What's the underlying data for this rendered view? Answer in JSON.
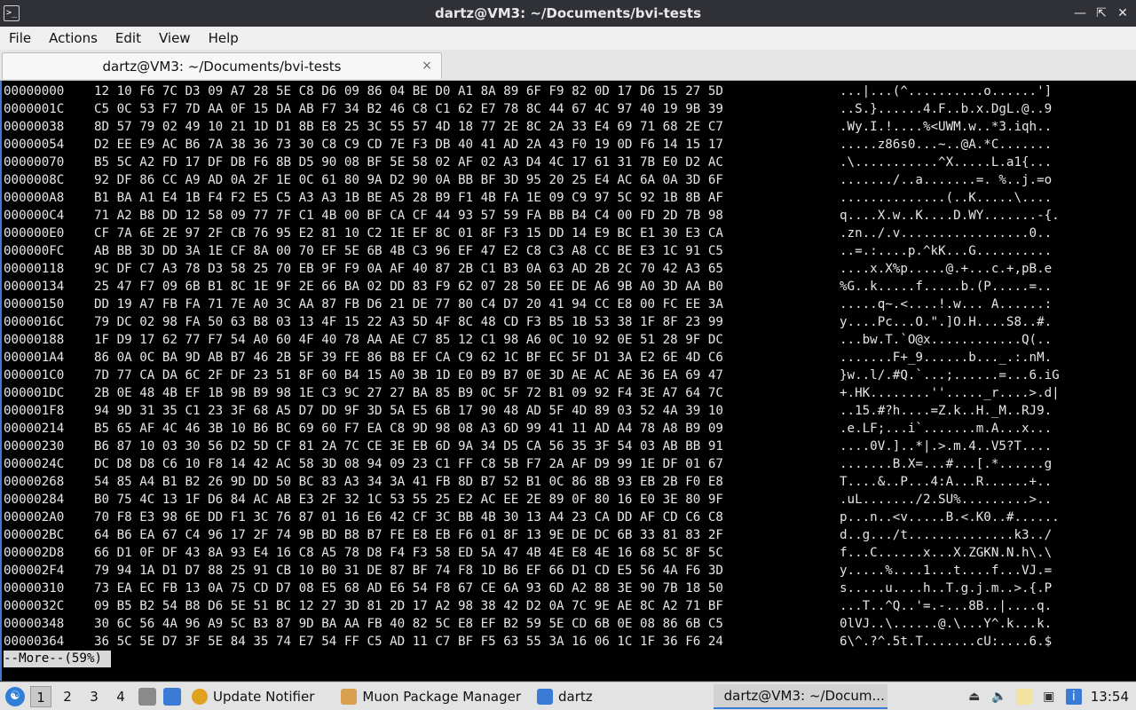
{
  "window": {
    "title": "dartz@VM3: ~/Documents/bvi-tests",
    "buttons": [
      "minimize",
      "restore",
      "close"
    ]
  },
  "menubar": {
    "items": [
      "File",
      "Actions",
      "Edit",
      "View",
      "Help"
    ]
  },
  "tab": {
    "label": "dartz@VM3: ~/Documents/bvi-tests",
    "close": "×"
  },
  "terminal": {
    "rows": [
      {
        "addr": "00000000",
        "bytes": "12 10 F6 7C D3 09 A7 28 5E C8 D6 09 86 04 BE D0 A1 8A 89 6F F9 82 0D 17 D6 15 27 5D",
        "ascii": "...|...(^..........o......']"
      },
      {
        "addr": "0000001C",
        "bytes": "C5 0C 53 F7 7D AA 0F 15 DA AB F7 34 B2 46 C8 C1 62 E7 78 8C 44 67 4C 97 40 19 9B 39",
        "ascii": "..S.}......4.F..b.x.DgL.@..9"
      },
      {
        "addr": "00000038",
        "bytes": "8D 57 79 02 49 10 21 1D D1 8B E8 25 3C 55 57 4D 18 77 2E 8C 2A 33 E4 69 71 68 2E C7",
        "ascii": ".Wy.I.!....%<UWM.w..*3.iqh.."
      },
      {
        "addr": "00000054",
        "bytes": "D2 EE E9 AC B6 7A 38 36 73 30 C8 C9 CD 7E F3 DB 40 41 AD 2A 43 F0 19 0D F6 14 15 17",
        "ascii": ".....z86s0...~..@A.*C......."
      },
      {
        "addr": "00000070",
        "bytes": "B5 5C A2 FD 17 DF DB F6 8B D5 90 08 BF 5E 58 02 AF 02 A3 D4 4C 17 61 31 7B E0 D2 AC",
        "ascii": ".\\...........^X.....L.a1{..."
      },
      {
        "addr": "0000008C",
        "bytes": "92 DF 86 CC A9 AD 0A 2F 1E 0C 61 80 9A D2 90 0A BB BF 3D 95 20 25 E4 AC 6A 0A 3D 6F",
        "ascii": "......./..a.......=. %..j.=o"
      },
      {
        "addr": "000000A8",
        "bytes": "B1 BA A1 E4 1B F4 F2 E5 C5 A3 A3 1B BE A5 28 B9 F1 4B FA 1E 09 C9 97 5C 92 1B 8B AF",
        "ascii": "..............(..K.....\\...."
      },
      {
        "addr": "000000C4",
        "bytes": "71 A2 B8 DD 12 58 09 77 7F C1 4B 00 BF CA CF 44 93 57 59 FA BB B4 C4 00 FD 2D 7B 98",
        "ascii": "q....X.w..K....D.WY.......-{."
      },
      {
        "addr": "000000E0",
        "bytes": "CF 7A 6E 2E 97 2F CB 76 95 E2 81 10 C2 1E EF 8C 01 8F F3 15 DD 14 E9 BC E1 30 E3 CA",
        "ascii": ".zn../.v.................0.."
      },
      {
        "addr": "000000FC",
        "bytes": "AB BB 3D DD 3A 1E CF 8A 00 70 EF 5E 6B 4B C3 96 EF 47 E2 C8 C3 A8 CC BE E3 1C 91 C5",
        "ascii": "..=.:....p.^kK...G.........."
      },
      {
        "addr": "00000118",
        "bytes": "9C DF C7 A3 78 D3 58 25 70 EB 9F F9 0A AF 40 87 2B C1 B3 0A 63 AD 2B 2C 70 42 A3 65",
        "ascii": "....x.X%p.....@.+...c.+,pB.e"
      },
      {
        "addr": "00000134",
        "bytes": "25 47 F7 09 6B B1 8C 1E 9F 2E 66 BA 02 DD 83 F9 62 07 28 50 EE DE A6 9B A0 3D AA B0",
        "ascii": "%G..k.....f.....b.(P.....=.."
      },
      {
        "addr": "00000150",
        "bytes": "DD 19 A7 FB FA 71 7E A0 3C AA 87 FB D6 21 DE 77 80 C4 D7 20 41 94 CC E8 00 FC EE 3A",
        "ascii": ".....q~.<....!.w... A......:"
      },
      {
        "addr": "0000016C",
        "bytes": "79 DC 02 98 FA 50 63 B8 03 13 4F 15 22 A3 5D 4F 8C 48 CD F3 B5 1B 53 38 1F 8F 23 99",
        "ascii": "y....Pc...O.\".]O.H....S8..#."
      },
      {
        "addr": "00000188",
        "bytes": "1F D9 17 62 77 F7 54 A0 60 4F 40 78 AA AE C7 85 12 C1 98 A6 0C 10 92 0E 51 28 9F DC",
        "ascii": "...bw.T.`O@x............Q(.."
      },
      {
        "addr": "000001A4",
        "bytes": "86 0A 0C BA 9D AB B7 46 2B 5F 39 FE 86 B8 EF CA C9 62 1C BF EC 5F D1 3A E2 6E 4D C6",
        "ascii": ".......F+_9......b..._.:.nM."
      },
      {
        "addr": "000001C0",
        "bytes": "7D 77 CA DA 6C 2F DF 23 51 8F 60 B4 15 A0 3B 1D E0 B9 B7 0E 3D AE AC AE 36 EA 69 47",
        "ascii": "}w..l/.#Q.`...;......=...6.iG"
      },
      {
        "addr": "000001DC",
        "bytes": "2B 0E 48 4B EF 1B 9B B9 98 1E C3 9C 27 27 BA 85 B9 0C 5F 72 B1 09 92 F4 3E A7 64 7C",
        "ascii": "+.HK........''....._r....>.d|"
      },
      {
        "addr": "000001F8",
        "bytes": "94 9D 31 35 C1 23 3F 68 A5 D7 DD 9F 3D 5A E5 6B 17 90 48 AD 5F 4D 89 03 52 4A 39 10",
        "ascii": "..15.#?h....=Z.k..H._M..RJ9."
      },
      {
        "addr": "00000214",
        "bytes": "B5 65 AF 4C 46 3B 10 B6 BC 69 60 F7 EA C8 9D 98 08 A3 6D 99 41 11 AD A4 78 A8 B9 09",
        "ascii": ".e.LF;...i`.......m.A...x..."
      },
      {
        "addr": "00000230",
        "bytes": "B6 87 10 03 30 56 D2 5D CF 81 2A 7C CE 3E EB 6D 9A 34 D5 CA 56 35 3F 54 03 AB BB 91",
        "ascii": "....0V.]..*|.>.m.4..V5?T...."
      },
      {
        "addr": "0000024C",
        "bytes": "DC D8 D8 C6 10 F8 14 42 AC 58 3D 08 94 09 23 C1 FF C8 5B F7 2A AF D9 99 1E DF 01 67",
        "ascii": ".......B.X=...#...[.*......g"
      },
      {
        "addr": "00000268",
        "bytes": "54 85 A4 B1 B2 26 9D DD 50 BC 83 A3 34 3A 41 FB 8D B7 52 B1 0C 86 8B 93 EB 2B F0 E8",
        "ascii": "T....&..P...4:A...R......+.."
      },
      {
        "addr": "00000284",
        "bytes": "B0 75 4C 13 1F D6 84 AC AB E3 2F 32 1C 53 55 25 E2 AC EE 2E 89 0F 80 16 E0 3E 80 9F",
        "ascii": ".uL......./2.SU%.........>.."
      },
      {
        "addr": "000002A0",
        "bytes": "70 F8 E3 98 6E DD F1 3C 76 87 01 16 E6 42 CF 3C BB 4B 30 13 A4 23 CA DD AF CD C6 C8",
        "ascii": "p...n..<v.....B.<.K0..#......"
      },
      {
        "addr": "000002BC",
        "bytes": "64 B6 EA 67 C4 96 17 2F 74 9B BD B8 B7 FE E8 EB F6 01 8F 13 9E DE DC 6B 33 81 83 2F",
        "ascii": "d..g.../t..............k3../"
      },
      {
        "addr": "000002D8",
        "bytes": "66 D1 0F DF 43 8A 93 E4 16 C8 A5 78 D8 F4 F3 58 ED 5A 47 4B 4E E8 4E 16 68 5C 8F 5C",
        "ascii": "f...C......x...X.ZGKN.N.h\\.\\"
      },
      {
        "addr": "000002F4",
        "bytes": "79 94 1A D1 D7 88 25 91 CB 10 B0 31 DE 87 BF 74 F8 1D B6 EF 66 D1 CD E5 56 4A F6 3D",
        "ascii": "y.....%....1...t....f...VJ.="
      },
      {
        "addr": "00000310",
        "bytes": "73 EA EC FB 13 0A 75 CD D7 08 E5 68 AD E6 54 F8 67 CE 6A 93 6D A2 88 3E 90 7B 18 50",
        "ascii": "s.....u....h..T.g.j.m..>.{.P"
      },
      {
        "addr": "0000032C",
        "bytes": "09 B5 B2 54 B8 D6 5E 51 BC 12 27 3D 81 2D 17 A2 98 38 42 D2 0A 7C 9E AE 8C A2 71 BF",
        "ascii": "...T..^Q..'=.-...8B..|....q."
      },
      {
        "addr": "00000348",
        "bytes": "30 6C 56 4A 96 A9 5C B3 87 9D BA AA FB 40 82 5C E8 EF B2 59 5E CD 6B 0E 08 86 6B C5",
        "ascii": "0lVJ..\\......@.\\...Y^.k...k."
      },
      {
        "addr": "00000364",
        "bytes": "36 5C 5E D7 3F 5E 84 35 74 E7 54 FF C5 AD 11 C7 BF F5 63 55 3A 16 06 1C 1F 36 F6 24",
        "ascii": "6\\^.?^.5t.T.......cU:....6.$"
      }
    ],
    "pager": "--More--(59%)"
  },
  "taskbar": {
    "workspaces": [
      "1",
      "2",
      "3",
      "4"
    ],
    "tasks": [
      "Update Notifier",
      "Muon Package Manager",
      "dartz",
      "dartz@VM3: ~/Docum..."
    ],
    "clock": "13:54"
  }
}
